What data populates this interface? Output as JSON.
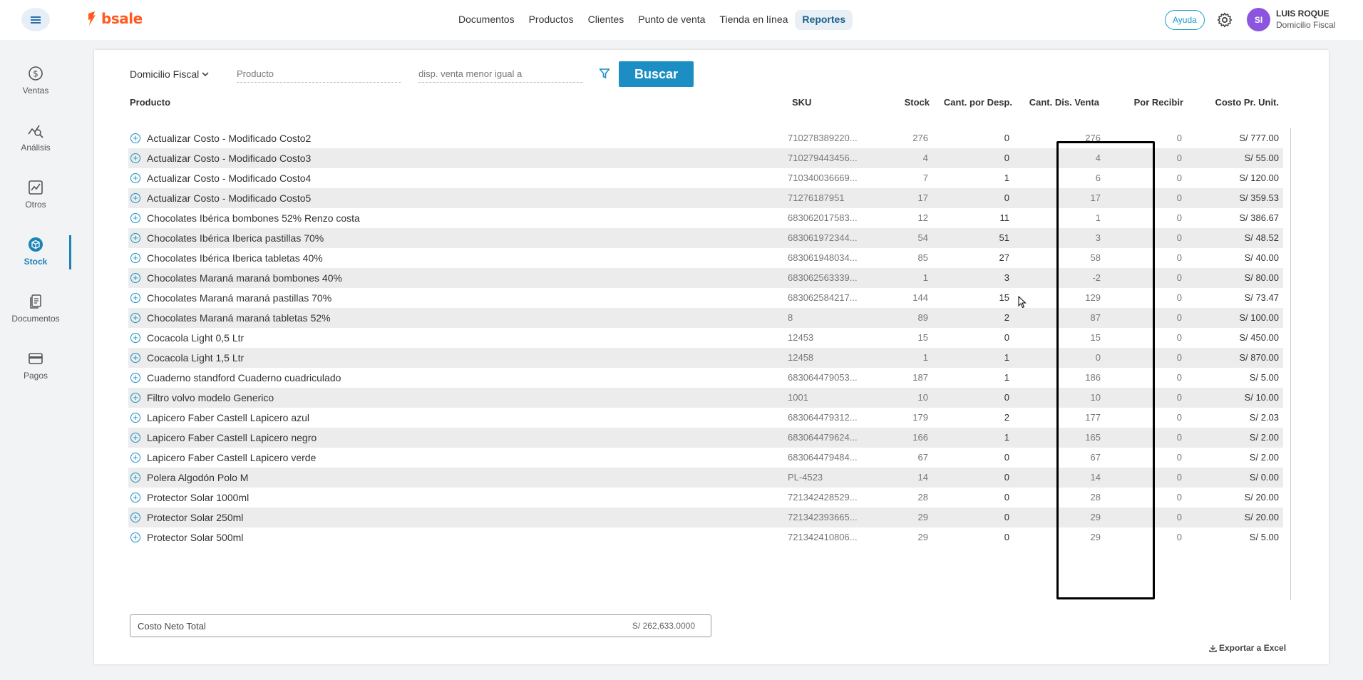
{
  "header": {
    "brand": "bsale",
    "nav": [
      {
        "label": "Documentos",
        "active": false
      },
      {
        "label": "Productos",
        "active": false
      },
      {
        "label": "Clientes",
        "active": false
      },
      {
        "label": "Punto de venta",
        "active": false
      },
      {
        "label": "Tienda en línea",
        "active": false
      },
      {
        "label": "Reportes",
        "active": true
      }
    ],
    "help_label": "Ayuda",
    "avatar_initials": "SI",
    "user_name": "LUIS ROQUE",
    "user_location": "Domicilio Fiscal"
  },
  "sidebar": {
    "items": [
      {
        "label": "Ventas",
        "icon": "dollar-icon",
        "active": false
      },
      {
        "label": "Análisis",
        "icon": "analysis-icon",
        "active": false
      },
      {
        "label": "Otros",
        "icon": "chart-icon",
        "active": false
      },
      {
        "label": "Stock",
        "icon": "box-icon",
        "active": true
      },
      {
        "label": "Documentos",
        "icon": "document-icon",
        "active": false
      },
      {
        "label": "Pagos",
        "icon": "card-icon",
        "active": false
      }
    ]
  },
  "filters": {
    "location": "Domicilio Fiscal",
    "product_placeholder": "Producto",
    "disp_placeholder": "disp. venta menor igual a",
    "search_label": "Buscar"
  },
  "table": {
    "columns": [
      "Producto",
      "SKU",
      "Stock",
      "Cant. por Desp.",
      "Cant. Dis. Venta",
      "Por Recibir",
      "Costo Pr. Unit."
    ],
    "rows": [
      {
        "producto": "Actualizar Costo - Modificado Costo2",
        "sku": "710278389220...",
        "stock": "276",
        "desp": "0",
        "disp": "276",
        "recibir": "0",
        "costo": "S/ 777.00"
      },
      {
        "producto": "Actualizar Costo - Modificado Costo3",
        "sku": "710279443456...",
        "stock": "4",
        "desp": "0",
        "disp": "4",
        "recibir": "0",
        "costo": "S/ 55.00"
      },
      {
        "producto": "Actualizar Costo - Modificado Costo4",
        "sku": "710340036669...",
        "stock": "7",
        "desp": "1",
        "disp": "6",
        "recibir": "0",
        "costo": "S/ 120.00"
      },
      {
        "producto": "Actualizar Costo - Modificado Costo5",
        "sku": "71276187951",
        "stock": "17",
        "desp": "0",
        "disp": "17",
        "recibir": "0",
        "costo": "S/ 359.53"
      },
      {
        "producto": "Chocolates Ibérica bombones 52% Renzo costa",
        "sku": "683062017583...",
        "stock": "12",
        "desp": "11",
        "disp": "1",
        "recibir": "0",
        "costo": "S/ 386.67"
      },
      {
        "producto": "Chocolates Ibérica Iberica pastillas 70%",
        "sku": "683061972344...",
        "stock": "54",
        "desp": "51",
        "disp": "3",
        "recibir": "0",
        "costo": "S/ 48.52"
      },
      {
        "producto": "Chocolates Ibérica Iberica tabletas 40%",
        "sku": "683061948034...",
        "stock": "85",
        "desp": "27",
        "disp": "58",
        "recibir": "0",
        "costo": "S/ 40.00"
      },
      {
        "producto": "Chocolates Maraná maraná bombones 40%",
        "sku": "683062563339...",
        "stock": "1",
        "desp": "3",
        "disp": "-2",
        "recibir": "0",
        "costo": "S/ 80.00"
      },
      {
        "producto": "Chocolates Maraná maraná pastillas 70%",
        "sku": "683062584217...",
        "stock": "144",
        "desp": "15",
        "disp": "129",
        "recibir": "0",
        "costo": "S/ 73.47"
      },
      {
        "producto": "Chocolates Maraná maraná tabletas 52%",
        "sku": "8",
        "stock": "89",
        "desp": "2",
        "disp": "87",
        "recibir": "0",
        "costo": "S/ 100.00"
      },
      {
        "producto": "Cocacola Light 0,5 Ltr",
        "sku": "12453",
        "stock": "15",
        "desp": "0",
        "disp": "15",
        "recibir": "0",
        "costo": "S/ 450.00"
      },
      {
        "producto": "Cocacola Light 1,5 Ltr",
        "sku": "12458",
        "stock": "1",
        "desp": "1",
        "disp": "0",
        "recibir": "0",
        "costo": "S/ 870.00"
      },
      {
        "producto": "Cuaderno standford Cuaderno cuadriculado",
        "sku": "683064479053...",
        "stock": "187",
        "desp": "1",
        "disp": "186",
        "recibir": "0",
        "costo": "S/ 5.00"
      },
      {
        "producto": "Filtro volvo modelo Generico",
        "sku": "1001",
        "stock": "10",
        "desp": "0",
        "disp": "10",
        "recibir": "0",
        "costo": "S/ 10.00"
      },
      {
        "producto": "Lapicero Faber Castell Lapicero azul",
        "sku": "683064479312...",
        "stock": "179",
        "desp": "2",
        "disp": "177",
        "recibir": "0",
        "costo": "S/ 2.03"
      },
      {
        "producto": "Lapicero Faber Castell Lapicero negro",
        "sku": "683064479624...",
        "stock": "166",
        "desp": "1",
        "disp": "165",
        "recibir": "0",
        "costo": "S/ 2.00"
      },
      {
        "producto": "Lapicero Faber Castell Lapicero verde",
        "sku": "683064479484...",
        "stock": "67",
        "desp": "0",
        "disp": "67",
        "recibir": "0",
        "costo": "S/ 2.00"
      },
      {
        "producto": "Polera Algodón Polo M",
        "sku": "PL-4523",
        "stock": "14",
        "desp": "0",
        "disp": "14",
        "recibir": "0",
        "costo": "S/ 0.00"
      },
      {
        "producto": "Protector Solar 1000ml",
        "sku": "721342428529...",
        "stock": "28",
        "desp": "0",
        "disp": "28",
        "recibir": "0",
        "costo": "S/ 20.00"
      },
      {
        "producto": "Protector Solar 250ml",
        "sku": "721342393665...",
        "stock": "29",
        "desp": "0",
        "disp": "29",
        "recibir": "0",
        "costo": "S/ 20.00"
      },
      {
        "producto": "Protector Solar 500ml",
        "sku": "721342410806...",
        "stock": "29",
        "desp": "0",
        "disp": "29",
        "recibir": "0",
        "costo": "S/ 5.00"
      }
    ]
  },
  "footer": {
    "total_label": "Costo Neto Total",
    "total_value": "S/ 262,633.0000",
    "export_label": "Exportar a Excel"
  },
  "colors": {
    "brand": "#ff5a1f",
    "accent": "#1c8ec4",
    "active_sidebar": "#1a83b8",
    "avatar": "#8b55e0"
  }
}
